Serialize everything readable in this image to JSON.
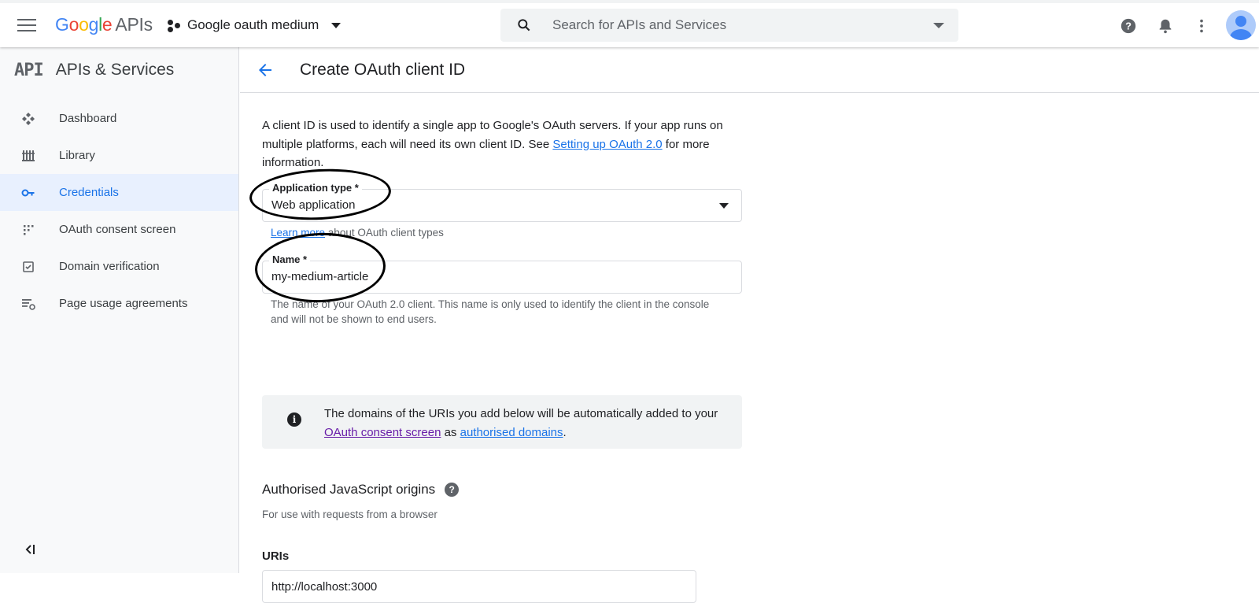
{
  "topbar": {
    "logo": {
      "google": "Google",
      "apis": "APIs"
    },
    "project_name": "Google oauth medium",
    "search_placeholder": "Search for APIs and Services"
  },
  "sidebar": {
    "mark": "API",
    "title": "APIs & Services",
    "items": [
      {
        "label": "Dashboard",
        "icon": "dashboard-icon"
      },
      {
        "label": "Library",
        "icon": "library-icon"
      },
      {
        "label": "Credentials",
        "icon": "key-icon",
        "active": true
      },
      {
        "label": "OAuth consent screen",
        "icon": "consent-icon"
      },
      {
        "label": "Domain verification",
        "icon": "checkbox-icon"
      },
      {
        "label": "Page usage agreements",
        "icon": "settings-list-icon"
      }
    ]
  },
  "page": {
    "title": "Create OAuth client ID",
    "intro_1": "A client ID is used to identify a single app to Google's OAuth servers. If your app runs on multiple platforms, each will need its own client ID. See ",
    "intro_link": "Setting up OAuth 2.0",
    "intro_2": " for more information.",
    "app_type": {
      "label": "Application type *",
      "value": "Web application",
      "hint_link": "Learn more",
      "hint_text": " about OAuth client types"
    },
    "name": {
      "label": "Name *",
      "value": "my-medium-article",
      "hint": "The name of your OAuth 2.0 client. This name is only used to identify the client in the console and will not be shown to end users."
    },
    "info": {
      "text_1": "The domains of the URIs you add below will be automatically added to your ",
      "link_1": "OAuth consent screen",
      "text_2": " as ",
      "link_2": "authorised domains",
      "text_3": "."
    },
    "js_origins": {
      "title": "Authorised JavaScript origins",
      "subtitle": "For use with requests from a browser",
      "uris_label": "URIs",
      "uri_value": "http://localhost:3000"
    }
  },
  "colors": {
    "accent": "#1a73e8",
    "active_bg": "#e8f0fe",
    "visited_link": "#681da8"
  }
}
